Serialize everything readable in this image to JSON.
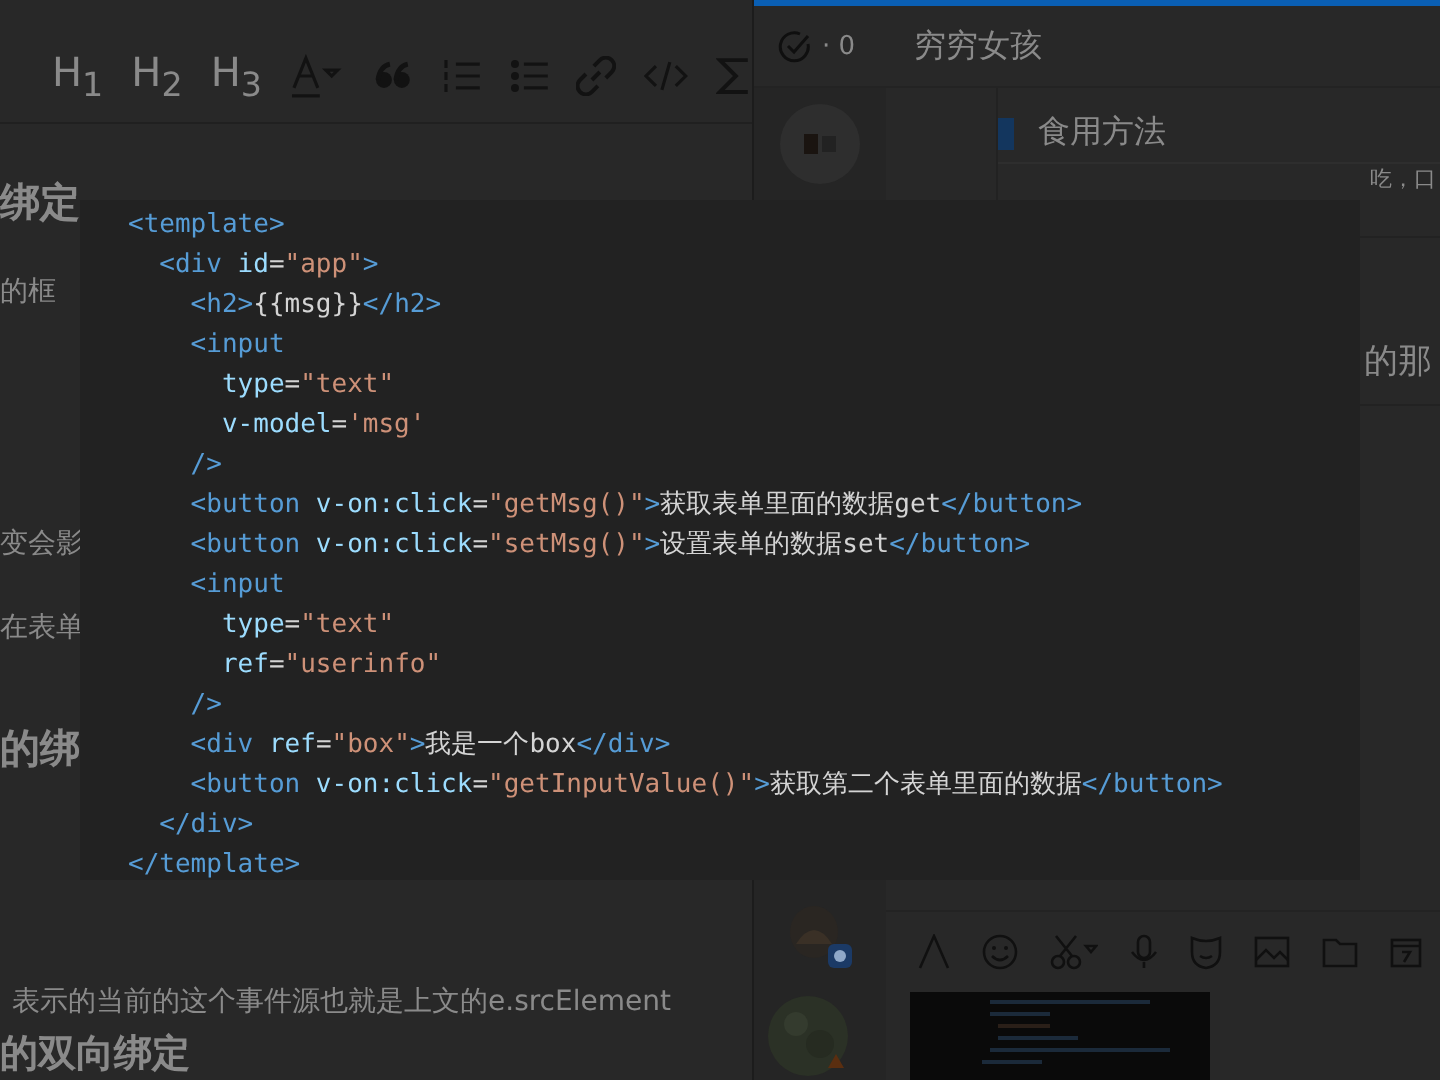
{
  "editor": {
    "toolbar": [
      {
        "label": "H$_{1}$"
      },
      {
        "label": "H$_{2}$"
      },
      {
        "label": "H$_{3}$"
      }
    ],
    "blocks": [
      {
        "kind": "heading",
        "text": "绑定"
      },
      {
        "kind": "para",
        "text": "的框"
      },
      {
        "kind": "para",
        "text": "变会影"
      },
      {
        "kind": "para",
        "text": "在表单"
      },
      {
        "kind": "heading",
        "text": "的绑"
      },
      {
        "kind": "para",
        "text": "表示的当前的这个事件源也就是上文的e.srcElement"
      },
      {
        "kind": "heading",
        "text": "的双向绑定"
      }
    ]
  },
  "chat": {
    "task_count": "· 0",
    "title": "穷穷女孩",
    "card_title": "食用方法",
    "card_text": "吃，口",
    "message_text": "的那"
  },
  "code_lines": [
    {
      "tokens": [
        {
          "kind": "tag",
          "text": "<template>"
        }
      ]
    },
    {
      "tokens": [
        {
          "kind": "tag",
          "text": "  <div"
        },
        {
          "kind": "attr",
          "text": " id"
        },
        {
          "kind": "plain",
          "text": "="
        },
        {
          "kind": "string",
          "text": "\"app\""
        },
        {
          "kind": "tag",
          "text": ">"
        }
      ]
    },
    {
      "tokens": [
        {
          "kind": "tag",
          "text": "    <h2>"
        },
        {
          "kind": "plain",
          "text": "{{msg}}"
        },
        {
          "kind": "tag",
          "text": "</h2>"
        }
      ]
    },
    {
      "tokens": [
        {
          "kind": "tag",
          "text": "    <input"
        }
      ]
    },
    {
      "tokens": [
        {
          "kind": "attr",
          "text": "      type"
        },
        {
          "kind": "plain",
          "text": "="
        },
        {
          "kind": "string",
          "text": "\"text\""
        }
      ]
    },
    {
      "tokens": [
        {
          "kind": "attr",
          "text": "      v-model"
        },
        {
          "kind": "plain",
          "text": "="
        },
        {
          "kind": "string",
          "text": "'msg'"
        }
      ]
    },
    {
      "tokens": [
        {
          "kind": "tag",
          "text": "    />"
        }
      ]
    },
    {
      "tokens": [
        {
          "kind": "tag",
          "text": "    <button"
        },
        {
          "kind": "attr",
          "text": " v-on:click"
        },
        {
          "kind": "plain",
          "text": "="
        },
        {
          "kind": "string",
          "text": "\"getMsg()\""
        },
        {
          "kind": "tag",
          "text": ">"
        },
        {
          "kind": "plain",
          "text": "获取表单里面的数据get"
        },
        {
          "kind": "tag",
          "text": "</button>"
        }
      ]
    },
    {
      "tokens": [
        {
          "kind": "tag",
          "text": "    <button"
        },
        {
          "kind": "attr",
          "text": " v-on:click"
        },
        {
          "kind": "plain",
          "text": "="
        },
        {
          "kind": "string",
          "text": "\"setMsg()\""
        },
        {
          "kind": "tag",
          "text": ">"
        },
        {
          "kind": "plain",
          "text": "设置表单的数据set"
        },
        {
          "kind": "tag",
          "text": "</button>"
        }
      ]
    },
    {
      "tokens": [
        {
          "kind": "tag",
          "text": "    <input"
        }
      ]
    },
    {
      "tokens": [
        {
          "kind": "attr",
          "text": "      type"
        },
        {
          "kind": "plain",
          "text": "="
        },
        {
          "kind": "string",
          "text": "\"text\""
        }
      ]
    },
    {
      "tokens": [
        {
          "kind": "attr",
          "text": "      ref"
        },
        {
          "kind": "plain",
          "text": "="
        },
        {
          "kind": "string",
          "text": "\"userinfo\""
        }
      ]
    },
    {
      "tokens": [
        {
          "kind": "tag",
          "text": "    />"
        }
      ]
    },
    {
      "tokens": [
        {
          "kind": "tag",
          "text": "    <div"
        },
        {
          "kind": "attr",
          "text": " ref"
        },
        {
          "kind": "plain",
          "text": "="
        },
        {
          "kind": "string",
          "text": "\"box\""
        },
        {
          "kind": "tag",
          "text": ">"
        },
        {
          "kind": "plain",
          "text": "我是一个box"
        },
        {
          "kind": "tag",
          "text": "</div>"
        }
      ]
    },
    {
      "tokens": [
        {
          "kind": "tag",
          "text": "    <button"
        },
        {
          "kind": "attr",
          "text": " v-on:click"
        },
        {
          "kind": "plain",
          "text": "="
        },
        {
          "kind": "string",
          "text": "\"getInputValue()\""
        },
        {
          "kind": "tag",
          "text": ">"
        },
        {
          "kind": "plain",
          "text": "获取第二个表单里面的数据"
        },
        {
          "kind": "tag",
          "text": "</button>"
        }
      ]
    },
    {
      "tokens": [
        {
          "kind": "tag",
          "text": "  </div>"
        }
      ]
    },
    {
      "tokens": [
        {
          "kind": "tag",
          "text": "</template>"
        }
      ]
    }
  ]
}
